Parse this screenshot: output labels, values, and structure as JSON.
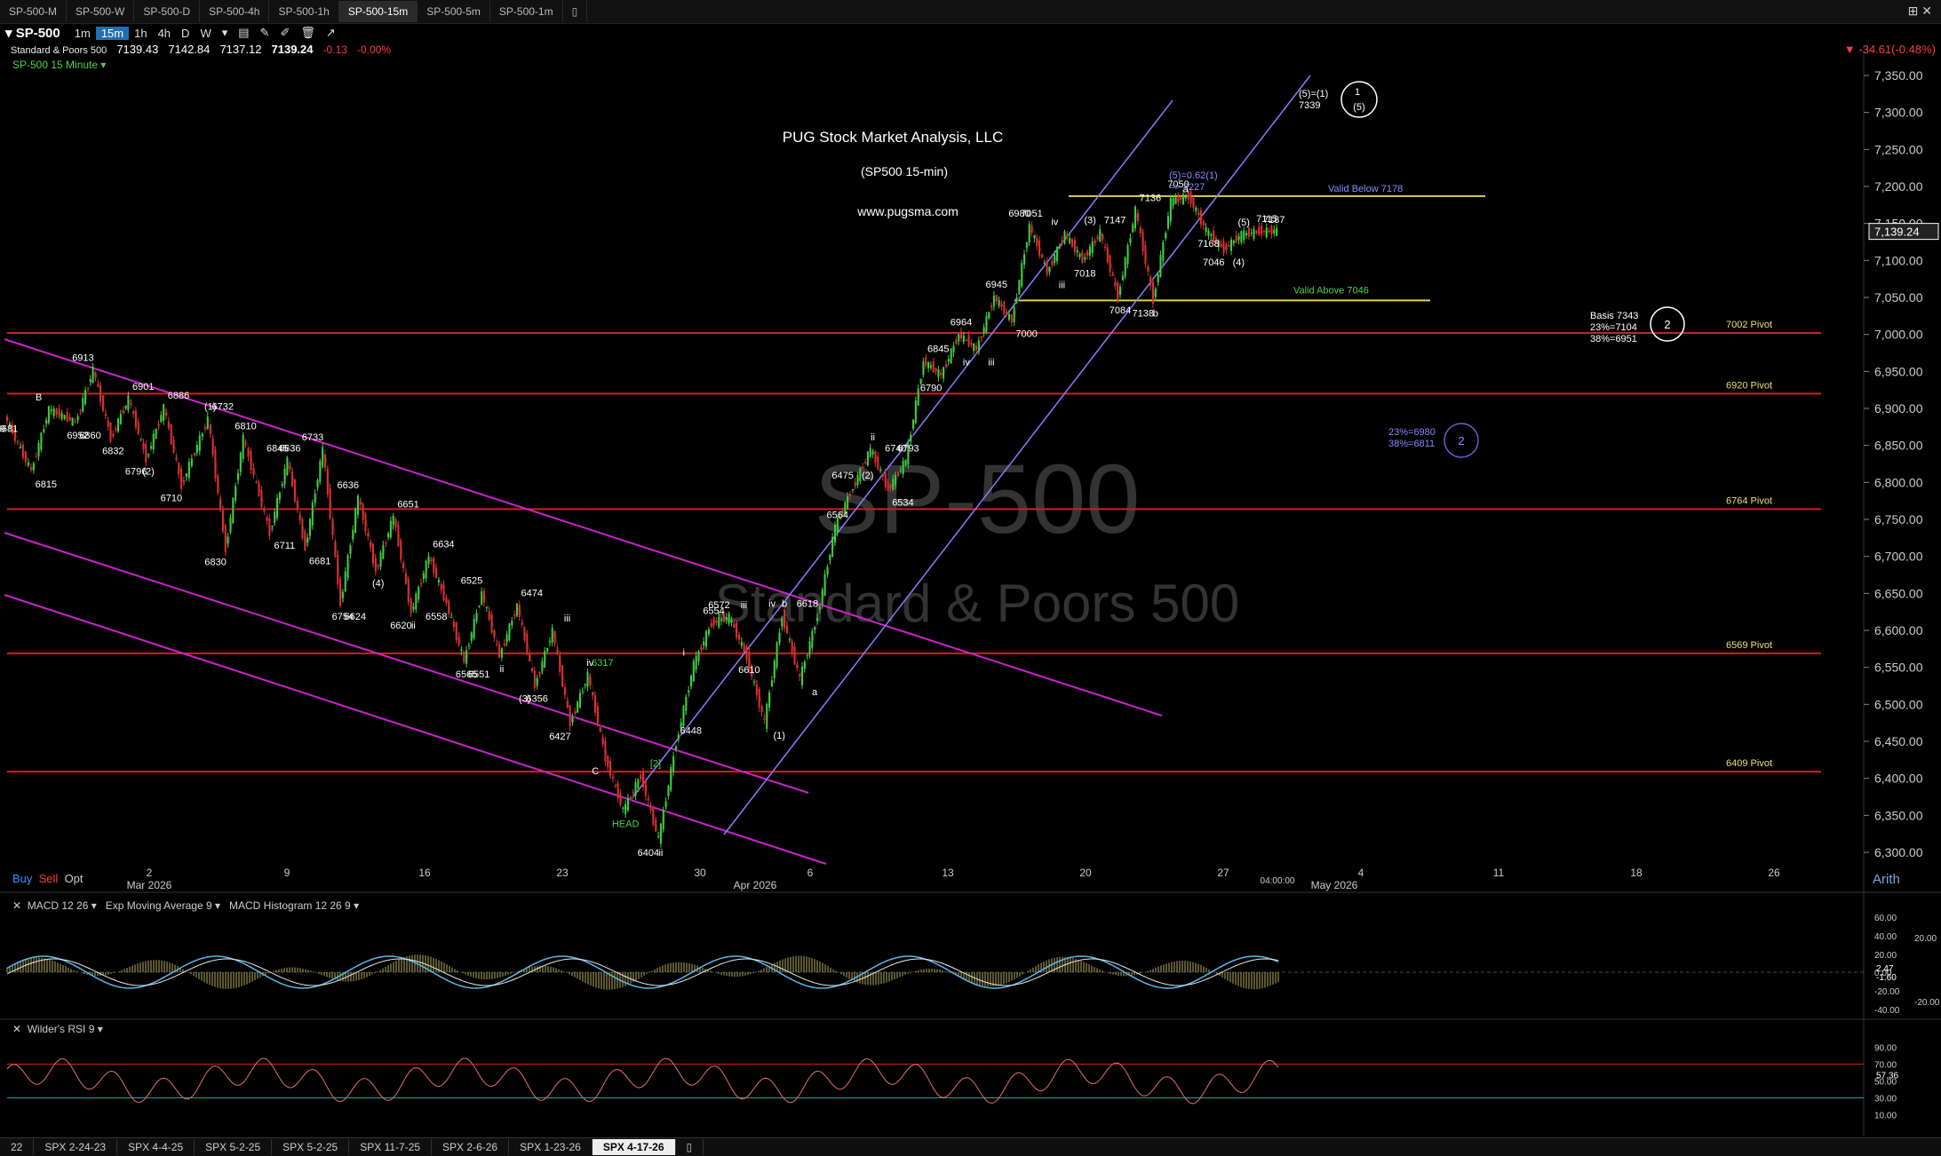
{
  "tabs": [
    "SP-500-M",
    "SP-500-W",
    "SP-500-D",
    "SP-500-4h",
    "SP-500-1h",
    "SP-500-15m",
    "SP-500-5m",
    "SP-500-1m"
  ],
  "active_tab": "SP-500-15m",
  "toolbar": {
    "symbol": "SP-500",
    "intervals": [
      "1m",
      "15m",
      "1h",
      "4h",
      "D",
      "W"
    ],
    "active_interval": "15m"
  },
  "quote": {
    "name": "Standard & Poors 500",
    "open": "7139.43",
    "high": "7142.84",
    "low": "7137.12",
    "close": "7139.24",
    "change": "-0.13",
    "change_pct": "-0.00%",
    "day_change": "-34.61(-0.48%)"
  },
  "panel_title": "SP-500 15 Minute",
  "watermark": {
    "symbol": "SP-500",
    "name": "Standard & Poors 500"
  },
  "annotation": {
    "company": "PUG Stock Market Analysis, LLC",
    "subtitle": "(SP500 15-min)",
    "website": "www.pugsma.com"
  },
  "price_axis": {
    "ticks": [
      "7,350.00",
      "7,300.00",
      "7,250.00",
      "7,200.00",
      "7,150.00",
      "7,100.00",
      "7,050.00",
      "7,000.00",
      "6,950.00",
      "6,900.00",
      "6,850.00",
      "6,800.00",
      "6,750.00",
      "6,700.00",
      "6,650.00",
      "6,600.00",
      "6,550.00",
      "6,500.00",
      "6,450.00",
      "6,400.00",
      "6,350.00",
      "6,300.00"
    ],
    "current": "7,139.24"
  },
  "date_axis": {
    "labels": [
      "2",
      "9",
      "16",
      "23",
      "30",
      "6",
      "13",
      "20",
      "27",
      "4",
      "11",
      "18",
      "26"
    ],
    "months": [
      "Mar 2026",
      "Apr 2026",
      "May 2026"
    ],
    "time_marker": "04:00:00"
  },
  "buy_sell": {
    "buy": "Buy",
    "sell": "Sell",
    "opt": "Opt"
  },
  "scale_mode": "Arith",
  "pivots": [
    {
      "label": "7002 Pivot",
      "value": 7002
    },
    {
      "label": "6920 Pivot",
      "value": 6920
    },
    {
      "label": "6764 Pivot",
      "value": 6764
    },
    {
      "label": "6569 Pivot",
      "value": 6569
    },
    {
      "label": "6409 Pivot",
      "value": 6409
    }
  ],
  "yellow_lines": [
    {
      "label": "Valid Below 7178",
      "value": 7187
    },
    {
      "label": "Valid Above 7046",
      "value": 7046
    }
  ],
  "targets": {
    "basis": "Basis 7343",
    "t23": "23%=7104",
    "t38": "38%=6951",
    "b23": "23%=6980",
    "b38": "38%=6811",
    "circle2a": "2",
    "circle2b": "2",
    "wave5": "(5)=(1)",
    "wave5val": "7339",
    "c1": "1",
    "c1b": "(5)",
    "fib": "(5)=0.62(1)",
    "fibval": "=> 7227"
  },
  "wave_labels": [
    "6899",
    "6681",
    "6815",
    "B",
    "6952",
    "6860",
    "6913",
    "6832",
    "6901",
    "6796",
    "(2)",
    "6886",
    "6710",
    "(1)",
    "6732",
    "6830",
    "6810",
    "6711",
    "6845",
    "6636",
    "6681",
    "6733",
    "6754",
    "6624",
    "6636",
    "(4)",
    "6651",
    "6620",
    "ii",
    "6634",
    "6558",
    "6565",
    "6551",
    "6525",
    "ii",
    "6474",
    "(3)",
    "6356",
    "iii",
    "6427",
    "iv",
    "6317",
    "C",
    "HEAD",
    "[2]",
    "6404",
    "ii",
    "6448",
    "i",
    "6554",
    "iii",
    "6572",
    "6610",
    "(1)",
    "iv",
    "b",
    "a",
    "6618",
    "6564",
    "(2)",
    "6475",
    "ii",
    "6534",
    "6740",
    "6793",
    "6845",
    "6790",
    "6964",
    "iii",
    "iv",
    "6945",
    "7000",
    "6980",
    "7051",
    "iii",
    "iv",
    "7018",
    "7147",
    "(3)",
    "7084",
    "7136",
    "7138",
    "b",
    "a",
    "7050",
    "7168",
    "(4)",
    "7046",
    "(5)",
    "7187",
    "7115"
  ],
  "macd": {
    "title": "MACD 12 26",
    "ema": "Exp Moving Average 9",
    "hist": "MACD Histogram 12 26 9",
    "ticks": [
      "60.00",
      "40.00",
      "20.00",
      "0.00",
      "-20.00",
      "-40.00"
    ],
    "right_ticks": [
      "20.00",
      "-20.00"
    ],
    "val1": "2.47",
    "val2": "-1.60"
  },
  "rsi": {
    "title": "Wilder's RSI 9",
    "ticks": [
      "90.00",
      "70.00",
      "50.00",
      "30.00",
      "10.00"
    ],
    "val": "57.36"
  },
  "bottom_tabs": [
    "22",
    "SPX 2-24-23",
    "SPX 4-4-25",
    "SPX 5-2-25",
    "SPX 5-2-25",
    "SPX 11-7-25",
    "SPX 2-6-26",
    "SPX 1-23-26",
    "SPX 4-17-26"
  ],
  "active_bottom": "SPX 4-17-26",
  "colors": {
    "bg": "#000000",
    "up": "#3fd13f",
    "down": "#e03030",
    "pivot": "#cc2020",
    "channel_up": "#8a7cff",
    "channel_down": "#cc22cc",
    "yellow": "#e0d040",
    "pivot_label": "#e8e070"
  },
  "chart_data": {
    "type": "line",
    "title": "PUG Stock Market Analysis, LLC",
    "ylim": [
      6285,
      7375
    ],
    "x": [
      0,
      3,
      5,
      8,
      10,
      12,
      14,
      16,
      18,
      20,
      23,
      25,
      27,
      30,
      32,
      34,
      36,
      38,
      40,
      42,
      44,
      46,
      48,
      50,
      52,
      54,
      56,
      58,
      60,
      62,
      64,
      66,
      68,
      70,
      72,
      74,
      76,
      78,
      80,
      82,
      84,
      86,
      88,
      90,
      92,
      94,
      96,
      98,
      100,
      102,
      104,
      106,
      108,
      110,
      112,
      114,
      116,
      118,
      120,
      122,
      124,
      126,
      128,
      130,
      132,
      134,
      136,
      138,
      140,
      142,
      144
    ],
    "values": [
      6890,
      6815,
      6899,
      6881,
      6952,
      6860,
      6913,
      6832,
      6901,
      6796,
      6886,
      6710,
      6860,
      6732,
      6830,
      6711,
      6845,
      6636,
      6780,
      6681,
      6754,
      6624,
      6700,
      6636,
      6558,
      6651,
      6565,
      6634,
      6525,
      6600,
      6474,
      6540,
      6427,
      6356,
      6404,
      6317,
      6448,
      6554,
      6610,
      6618,
      6564,
      6475,
      6620,
      6534,
      6620,
      6740,
      6793,
      6845,
      6790,
      6830,
      6964,
      6945,
      7000,
      6980,
      7051,
      7018,
      7147,
      7084,
      7136,
      7100,
      7138,
      7050,
      7168,
      7046,
      7180,
      7187,
      7140,
      7115,
      7135,
      7139,
      7140
    ],
    "series": [
      {
        "values": [
          6890,
          6815,
          6899,
          6881,
          6952,
          6860,
          6913,
          6832,
          6901,
          6796,
          6886,
          6710,
          6860,
          6732,
          6830,
          6711,
          6845,
          6636,
          6780,
          6681,
          6754,
          6624,
          6700,
          6636,
          6558,
          6651,
          6565,
          6634,
          6525,
          6600,
          6474,
          6540,
          6427,
          6356,
          6404,
          6317,
          6448,
          6554,
          6610,
          6618,
          6564,
          6475,
          6620,
          6534,
          6620,
          6740,
          6793,
          6845,
          6790,
          6830,
          6964,
          6945,
          7000,
          6980,
          7051,
          7018,
          7147,
          7084,
          7136,
          7100,
          7138,
          7050,
          7168,
          7046,
          7180,
          7187,
          7140,
          7115,
          7135,
          7139,
          7140
        ]
      }
    ]
  }
}
